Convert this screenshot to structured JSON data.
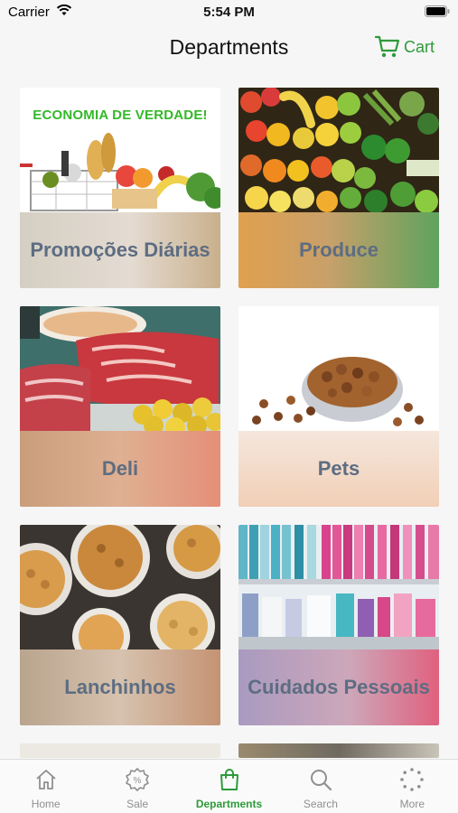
{
  "status_bar": {
    "carrier": "Carrier",
    "time": "5:54 PM"
  },
  "header": {
    "title": "Departments",
    "cart_label": "Cart"
  },
  "departments": [
    {
      "label": "Promoções Diárias",
      "banner": "ECONOMIA DE VERDADE!"
    },
    {
      "label": "Produce"
    },
    {
      "label": "Deli"
    },
    {
      "label": "Pets"
    },
    {
      "label": "Lanchinhos"
    },
    {
      "label": "Cuidados Pessoais"
    }
  ],
  "tab_bar": {
    "items": [
      {
        "label": "Home",
        "icon": "home-icon"
      },
      {
        "label": "Sale",
        "icon": "sale-icon"
      },
      {
        "label": "Departments",
        "icon": "shopping-bag-icon",
        "active": true
      },
      {
        "label": "Search",
        "icon": "search-icon"
      },
      {
        "label": "More",
        "icon": "more-icon"
      }
    ]
  },
  "colors": {
    "accent": "#2e9a3a",
    "tile_label": "#5d6d82",
    "inactive_tab": "#8f8f8f"
  }
}
